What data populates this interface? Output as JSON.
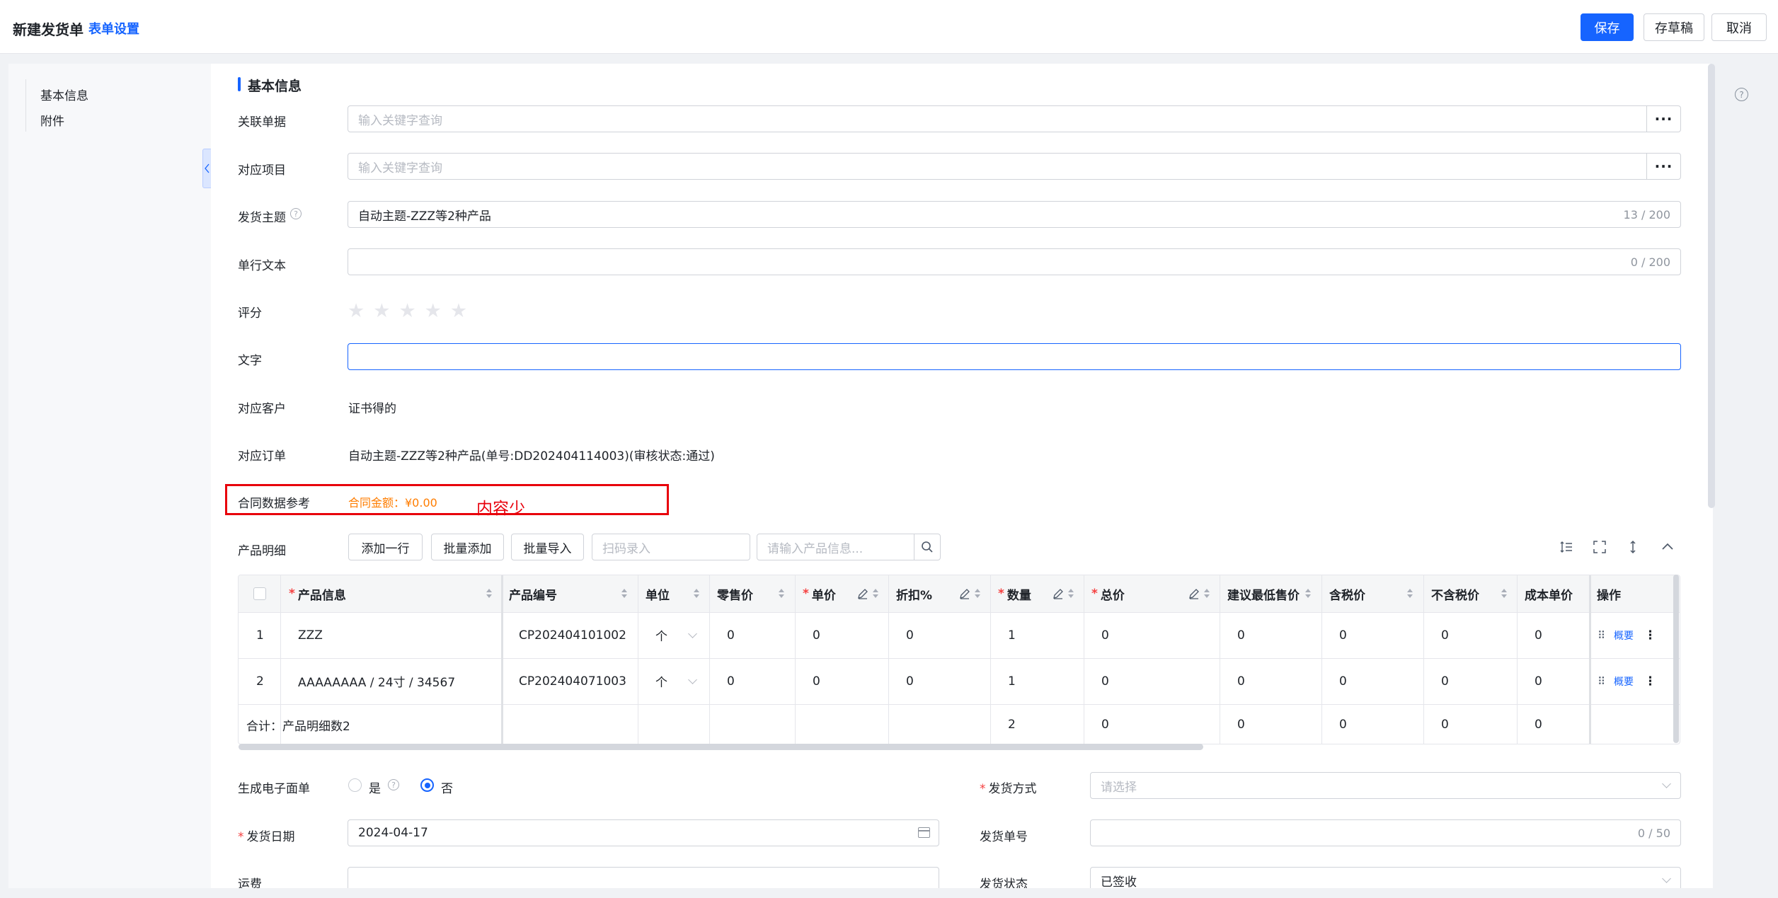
{
  "header": {
    "title": "新建发货单",
    "settings_link": "表单设置",
    "save": "保存",
    "draft": "存草稿",
    "cancel": "取消"
  },
  "sidebar": {
    "items": [
      "基本信息",
      "附件"
    ]
  },
  "section": {
    "title": "基本信息"
  },
  "form": {
    "related_doc": {
      "label": "关联单据",
      "placeholder": "输入关键字查询",
      "more": "···"
    },
    "project": {
      "label": "对应项目",
      "placeholder": "输入关键字查询",
      "more": "···"
    },
    "subject": {
      "label": "发货主题",
      "value": "自动主题-ZZZ等2种产品",
      "counter": "13 / 200"
    },
    "single_text": {
      "label": "单行文本",
      "counter": "0 / 200"
    },
    "rating": {
      "label": "评分",
      "value": 0,
      "max": 5
    },
    "text": {
      "label": "文字",
      "value": ""
    },
    "customer": {
      "label": "对应客户",
      "value": "证书得的"
    },
    "order": {
      "label": "对应订单",
      "value": "自动主题-ZZZ等2种产品(单号:DD202404114003)(审核状态:通过)"
    },
    "contract": {
      "label": "合同数据参考",
      "value": "合同金额：¥0.00"
    },
    "annotation": "内容少"
  },
  "products": {
    "label": "产品明细",
    "add_row": "添加一行",
    "batch_add": "批量添加",
    "batch_import": "批量导入",
    "scan_placeholder": "扫码录入",
    "search_placeholder": "请输入产品信息...",
    "columns": [
      "产品信息",
      "产品编号",
      "单位",
      "零售价",
      "单价",
      "折扣%",
      "数量",
      "总价",
      "建议最低售价",
      "含税价",
      "不含税价",
      "成本单价",
      "操作"
    ],
    "rows": [
      {
        "index": "1",
        "info": "ZZZ",
        "code": "CP202404101002",
        "unit": "个",
        "retail": "0",
        "price": "0",
        "discount": "0",
        "qty": "1",
        "total": "0",
        "min_price": "0",
        "tax_incl": "0",
        "tax_excl": "0",
        "cost": "0",
        "action": "概要"
      },
      {
        "index": "2",
        "info": "AAAAAAAA / 24寸 / 34567",
        "code": "CP202404071003",
        "unit": "个",
        "retail": "0",
        "price": "0",
        "discount": "0",
        "qty": "1",
        "total": "0",
        "min_price": "0",
        "tax_incl": "0",
        "tax_excl": "0",
        "cost": "0",
        "action": "概要"
      }
    ],
    "summary": {
      "label": "合计：产品明细数2",
      "qty": "2",
      "total": "0",
      "min_price": "0",
      "tax_incl": "0",
      "tax_excl": "0",
      "cost": "0"
    }
  },
  "bottom": {
    "e_waybill": {
      "label": "生成电子面单",
      "yes": "是",
      "no": "否",
      "selected": "否"
    },
    "ship_method": {
      "label": "发货方式",
      "placeholder": "请选择"
    },
    "ship_date": {
      "label": "发货日期",
      "value": "2024-04-17"
    },
    "ship_no": {
      "label": "发货单号",
      "counter": "0 / 50"
    },
    "freight": {
      "label": "运费",
      "value": ""
    },
    "ship_status": {
      "label": "发货状态",
      "value": "已签收"
    }
  },
  "colors": {
    "primary": "#1664ff",
    "required": "#f53f3f",
    "contract": "#ff7d00",
    "annotation": "#e8000b"
  }
}
